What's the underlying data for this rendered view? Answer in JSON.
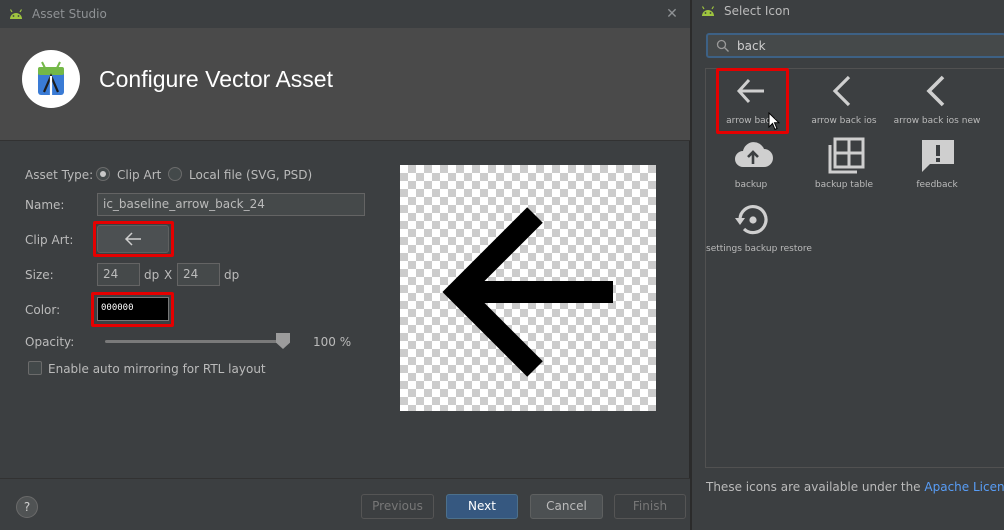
{
  "asset_studio": {
    "window_title": "Asset Studio",
    "page_title": "Configure Vector Asset",
    "asset_type": {
      "label": "Asset Type:",
      "options": [
        "Clip Art",
        "Local file (SVG, PSD)"
      ],
      "selected": "Clip Art"
    },
    "name": {
      "label": "Name:",
      "value": "ic_baseline_arrow_back_24"
    },
    "clip_art": {
      "label": "Clip Art:",
      "icon": "arrow-back-icon"
    },
    "size": {
      "label": "Size:",
      "width": "24",
      "height": "24",
      "unit": "dp",
      "separator": "X"
    },
    "color": {
      "label": "Color:",
      "value": "000000"
    },
    "opacity": {
      "label": "Opacity:",
      "value": "100 %",
      "level": 1.0
    },
    "rtl": {
      "label": "Enable auto mirroring for RTL layout",
      "checked": false
    },
    "buttons": {
      "help": "?",
      "previous": "Previous",
      "next": "Next",
      "cancel": "Cancel",
      "finish": "Finish"
    }
  },
  "select_icon": {
    "window_title": "Select Icon",
    "search": {
      "value": "back",
      "placeholder": ""
    },
    "icons": [
      {
        "label": "arrow back",
        "icon": "arrow-back-icon",
        "selected": true
      },
      {
        "label": "arrow back ios",
        "icon": "arrow-back-ios-icon",
        "selected": false
      },
      {
        "label": "arrow back ios new",
        "icon": "arrow-back-ios-new-icon",
        "selected": false
      },
      {
        "label": "backup",
        "icon": "cloud-upload-icon",
        "selected": false
      },
      {
        "label": "backup table",
        "icon": "backup-table-icon",
        "selected": false
      },
      {
        "label": "feedback",
        "icon": "feedback-icon",
        "selected": false
      },
      {
        "label": "settings backup restore",
        "icon": "settings-backup-restore-icon",
        "selected": false
      }
    ],
    "license": {
      "text": "These icons are available under the ",
      "link": "Apache License Versi"
    }
  },
  "colors": {
    "background": "#3c3f41",
    "header": "#4a4a4a",
    "accent": "#365880",
    "highlight": "#e50000",
    "link": "#589df6"
  }
}
